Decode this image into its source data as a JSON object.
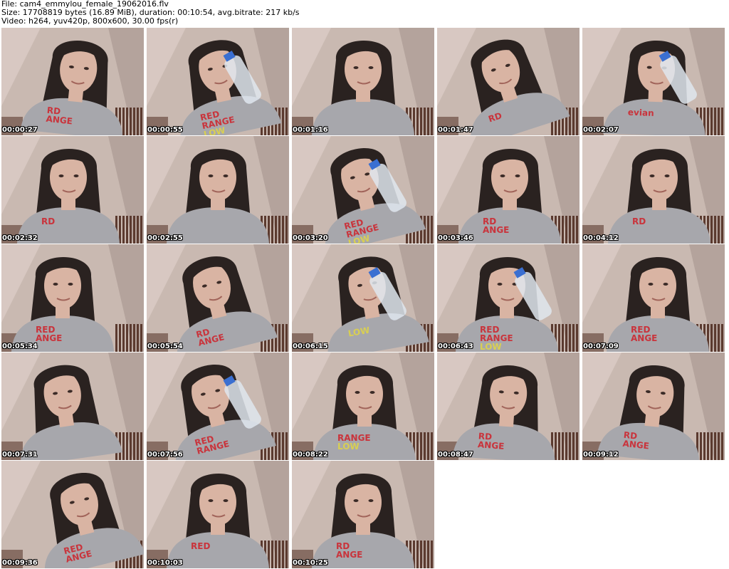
{
  "header": {
    "file_line": "File: cam4_emmylou_female_19062016.flv",
    "size_line": "Size: 17708819 bytes (16.89 MiB), duration: 00:10:54, avg.bitrate: 217 kb/s",
    "video_line": "Video: h264, yuv420p, 800x600, 30.00 fps(r)"
  },
  "thumbnails": [
    {
      "timestamp": "00:00:27",
      "shirt": "RD ANGE",
      "bottle": false
    },
    {
      "timestamp": "00:00:55",
      "shirt": "RED RANGE LOW",
      "bottle": true
    },
    {
      "timestamp": "00:01:16",
      "shirt": "",
      "bottle": false
    },
    {
      "timestamp": "00:01:47",
      "shirt": "RD",
      "bottle": false
    },
    {
      "timestamp": "00:02:07",
      "shirt": "evian",
      "bottle": true
    },
    {
      "timestamp": "00:02:32",
      "shirt": "RD",
      "bottle": false
    },
    {
      "timestamp": "00:02:55",
      "shirt": "",
      "bottle": false
    },
    {
      "timestamp": "00:03:20",
      "shirt": "RED RANGE LOW",
      "bottle": true
    },
    {
      "timestamp": "00:03:46",
      "shirt": "RD ANGE",
      "bottle": false
    },
    {
      "timestamp": "00:04:12",
      "shirt": "RD",
      "bottle": false
    },
    {
      "timestamp": "00:05:34",
      "shirt": "RED ANGE",
      "bottle": false
    },
    {
      "timestamp": "00:05:54",
      "shirt": "RD ANGE",
      "bottle": false
    },
    {
      "timestamp": "00:06:15",
      "shirt": "LOW",
      "bottle": true
    },
    {
      "timestamp": "00:06:43",
      "shirt": "RED RANGE LOW",
      "bottle": true
    },
    {
      "timestamp": "00:07:09",
      "shirt": "RED ANGE",
      "bottle": false
    },
    {
      "timestamp": "00:07:31",
      "shirt": "",
      "bottle": false
    },
    {
      "timestamp": "00:07:56",
      "shirt": "RED RANGE",
      "bottle": true
    },
    {
      "timestamp": "00:08:22",
      "shirt": "RANGE LOW",
      "bottle": false
    },
    {
      "timestamp": "00:08:47",
      "shirt": "RD ANGE",
      "bottle": false
    },
    {
      "timestamp": "00:09:12",
      "shirt": "RD ANGE",
      "bottle": false
    },
    {
      "timestamp": "00:09:36",
      "shirt": "RED ANGE",
      "bottle": false
    },
    {
      "timestamp": "00:10:03",
      "shirt": "RED",
      "bottle": false
    },
    {
      "timestamp": "00:10:25",
      "shirt": "RD ANGE",
      "bottle": false
    }
  ],
  "colors": {
    "wall": "#c9b9b1",
    "wall_shadow": "#8d7c76",
    "hair": "#2a2220",
    "skin": "#d9b4a3",
    "shirt": "#a7a7ac",
    "print_red": "#c9343c",
    "print_yellow": "#d9cf52",
    "headboard": "#5b3a2f"
  }
}
